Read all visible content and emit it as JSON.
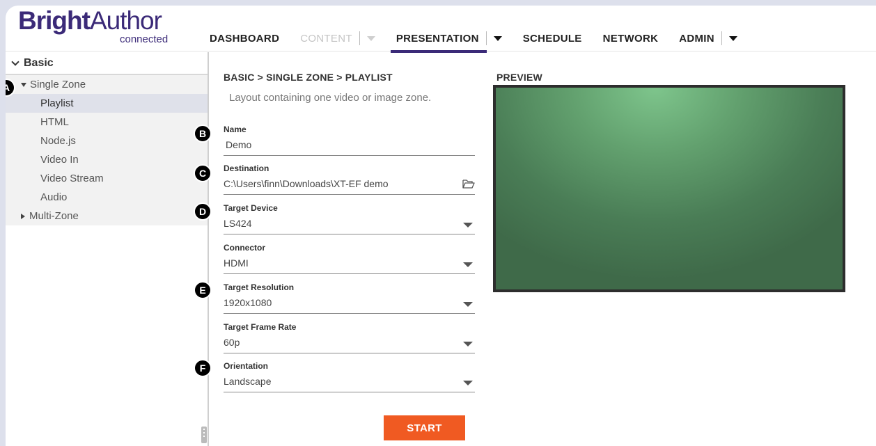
{
  "app": {
    "logo_bold": "Bright",
    "logo_light": "Author",
    "logo_sub": "connected",
    "brand_color": "#3b2a78",
    "accent_color": "#f05a22"
  },
  "nav": {
    "items": [
      {
        "label": "DASHBOARD",
        "state": "normal",
        "has_dropdown": false
      },
      {
        "label": "CONTENT",
        "state": "disabled",
        "has_dropdown": true
      },
      {
        "label": "PRESENTATION",
        "state": "active",
        "has_dropdown": true
      },
      {
        "label": "SCHEDULE",
        "state": "normal",
        "has_dropdown": false
      },
      {
        "label": "NETWORK",
        "state": "normal",
        "has_dropdown": false
      },
      {
        "label": "ADMIN",
        "state": "normal",
        "has_dropdown": true
      }
    ]
  },
  "sidebar": {
    "section_title": "Basic",
    "groups": [
      {
        "label": "Single Zone",
        "expanded": true,
        "items": [
          "Playlist",
          "HTML",
          "Node.js",
          "Video In",
          "Video Stream",
          "Audio"
        ],
        "selected": "Playlist"
      },
      {
        "label": "Multi-Zone",
        "expanded": false
      }
    ]
  },
  "form": {
    "breadcrumb": "BASIC > SINGLE ZONE > PLAYLIST",
    "description": "Layout containing one video or image zone.",
    "fields": [
      {
        "label": "Name",
        "value": "Demo",
        "type": "text"
      },
      {
        "label": "Destination",
        "value": "C:\\Users\\finn\\Downloads\\XT-EF demo",
        "type": "folder",
        "icon": "folder-open-icon"
      },
      {
        "label": "Target Device",
        "value": "LS424",
        "type": "select"
      },
      {
        "label": "Connector",
        "value": "HDMI",
        "type": "select"
      },
      {
        "label": "Target Resolution",
        "value": "1920x1080",
        "type": "select"
      },
      {
        "label": "Target Frame Rate",
        "value": "60p",
        "type": "select"
      },
      {
        "label": "Orientation",
        "value": "Landscape",
        "type": "select"
      }
    ],
    "start_label": "START"
  },
  "preview": {
    "title": "PREVIEW",
    "fill_color": "#5e9b6a"
  },
  "callouts": [
    "A",
    "B",
    "C",
    "D",
    "E",
    "F"
  ]
}
